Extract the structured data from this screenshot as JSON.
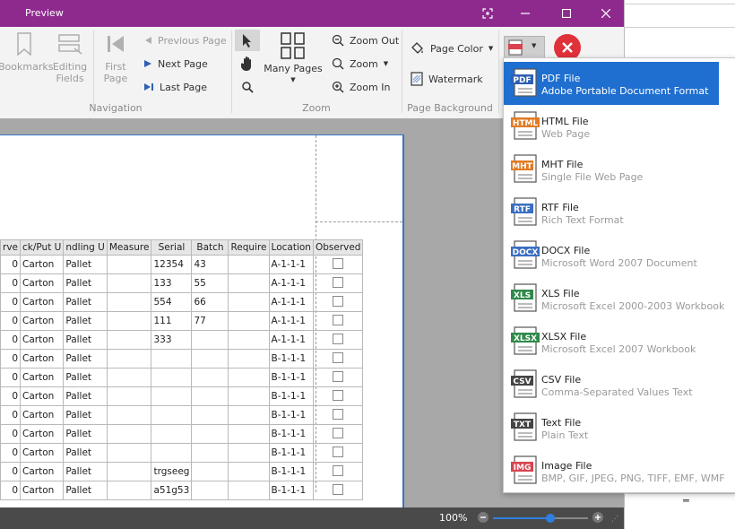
{
  "window": {
    "title": "Preview"
  },
  "ribbon": {
    "navigation": {
      "label": "Navigation",
      "bookmarks": "Bookmarks",
      "editing_fields": [
        "Editing",
        "Fields"
      ],
      "first_page": [
        "First",
        "Page"
      ],
      "previous_page": "Previous Page",
      "next_page": "Next Page",
      "last_page": "Last Page"
    },
    "zoom": {
      "label": "Zoom",
      "many_pages": "Many Pages",
      "zoom_out": "Zoom Out",
      "zoom": "Zoom",
      "zoom_in": "Zoom In"
    },
    "page_background": {
      "label": "Page Background",
      "page_color": "Page Color",
      "watermark": "Watermark"
    }
  },
  "table": {
    "headers": [
      "rve",
      "ck/Put U",
      "ndling U",
      "Measure",
      "Serial",
      "Batch",
      "Require",
      "Location",
      "Observed"
    ],
    "rows": [
      [
        "0",
        "Carton",
        "Pallet",
        "",
        "12354",
        "43",
        "",
        "A-1-1-1"
      ],
      [
        "0",
        "Carton",
        "Pallet",
        "",
        "133",
        "55",
        "",
        "A-1-1-1"
      ],
      [
        "0",
        "Carton",
        "Pallet",
        "",
        "554",
        "66",
        "",
        "A-1-1-1"
      ],
      [
        "0",
        "Carton",
        "Pallet",
        "",
        "111",
        "77",
        "",
        "A-1-1-1"
      ],
      [
        "0",
        "Carton",
        "Pallet",
        "",
        "333",
        "",
        "",
        "A-1-1-1"
      ],
      [
        "0",
        "Carton",
        "Pallet",
        "",
        "",
        "",
        "",
        "B-1-1-1"
      ],
      [
        "0",
        "Carton",
        "Pallet",
        "",
        "",
        "",
        "",
        "B-1-1-1"
      ],
      [
        "0",
        "Carton",
        "Pallet",
        "",
        "",
        "",
        "",
        "B-1-1-1"
      ],
      [
        "0",
        "Carton",
        "Pallet",
        "",
        "",
        "",
        "",
        "B-1-1-1"
      ],
      [
        "0",
        "Carton",
        "Pallet",
        "",
        "",
        "",
        "",
        "B-1-1-1"
      ],
      [
        "0",
        "Carton",
        "Pallet",
        "",
        "",
        "",
        "",
        "B-1-1-1"
      ],
      [
        "0",
        "Carton",
        "Pallet",
        "",
        "trgseeg",
        "",
        "",
        "B-1-1-1"
      ],
      [
        "0",
        "Carton",
        "Pallet",
        "",
        "a51g53",
        "",
        "",
        "B-1-1-1"
      ]
    ]
  },
  "status": {
    "zoom_level": "100%",
    "zoom_fraction": 0.6
  },
  "export_menu": {
    "items": [
      {
        "badge": "PDF",
        "title": "PDF File",
        "subtitle": "Adobe Portable Document Format",
        "color": "#2f5fb3"
      },
      {
        "badge": "HTML",
        "title": "HTML File",
        "subtitle": "Web Page",
        "color": "#e07b24"
      },
      {
        "badge": "MHT",
        "title": "MHT File",
        "subtitle": "Single File Web Page",
        "color": "#e07b24"
      },
      {
        "badge": "RTF",
        "title": "RTF File",
        "subtitle": "Rich Text Format",
        "color": "#3a6fc0"
      },
      {
        "badge": "DOCX",
        "title": "DOCX File",
        "subtitle": "Microsoft Word 2007 Document",
        "color": "#3a6fc0"
      },
      {
        "badge": "XLS",
        "title": "XLS File",
        "subtitle": "Microsoft Excel 2000-2003 Workbook",
        "color": "#2f8a4a"
      },
      {
        "badge": "XLSX",
        "title": "XLSX File",
        "subtitle": "Microsoft Excel 2007 Workbook",
        "color": "#2f8a4a"
      },
      {
        "badge": "CSV",
        "title": "CSV File",
        "subtitle": "Comma-Separated Values Text",
        "color": "#444444"
      },
      {
        "badge": "TXT",
        "title": "Text File",
        "subtitle": "Plain Text",
        "color": "#444444"
      },
      {
        "badge": "IMG",
        "title": "Image File",
        "subtitle": "BMP, GIF, JPEG, PNG, TIFF, EMF, WMF",
        "color": "#d9434f"
      }
    ]
  },
  "colors": {
    "titlebar": "#8e2a8e",
    "accent": "#1f6fd0",
    "close_red": "#e0303a"
  }
}
